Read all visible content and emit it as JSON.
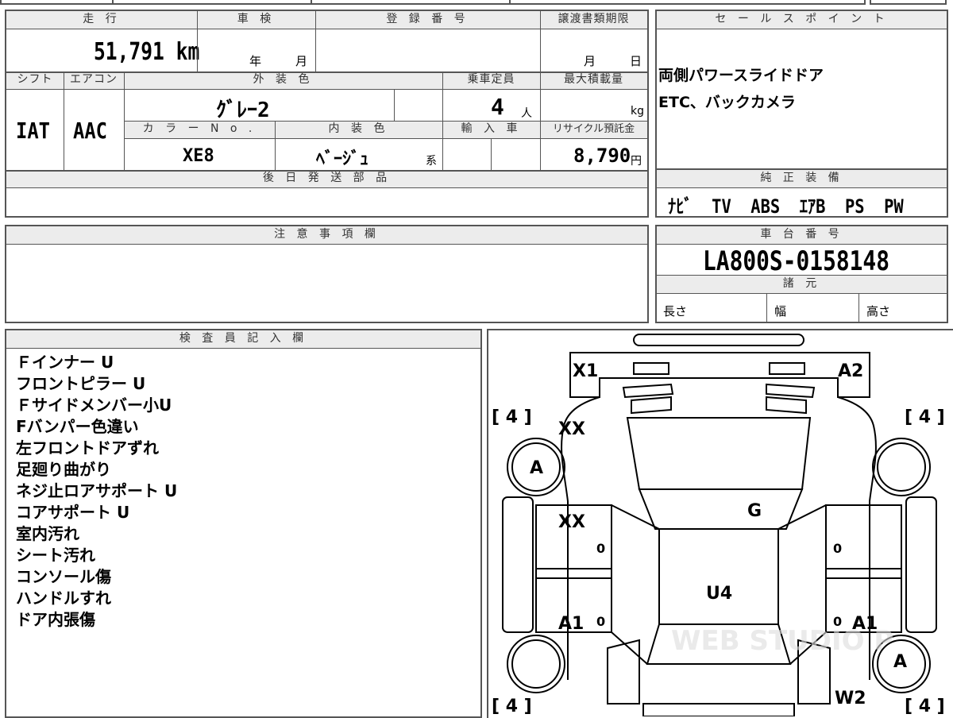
{
  "vehicle": {
    "mileage_label": "走 行",
    "mileage": "51,791 km",
    "inspection_label": "車 検",
    "inspection_year_unit": "年",
    "inspection_month_unit": "月",
    "registration_label": "登 録 番 号",
    "transfer_label": "譲渡書類期限",
    "transfer_month_unit": "月",
    "transfer_day_unit": "日",
    "shift_label": "シフト",
    "shift": "IAT",
    "aircon_label": "エアコン",
    "aircon": "AAC",
    "exterior_color_label": "外 装 色",
    "exterior_color": "ｸﾞﾚｰ2",
    "color_no_label": "カ ラ ー N o .",
    "color_no": "XE8",
    "interior_color_label": "内 装 色",
    "interior_color": "ﾍﾞｰｼﾞｭ",
    "interior_suffix": "系",
    "capacity_label": "乗車定員",
    "capacity": "4",
    "capacity_unit": "人",
    "max_load_label": "最大積載量",
    "max_load_unit": "kg",
    "import_label": "輸 入 車",
    "recycle_label": "リサイクル預託金",
    "recycle_fee": "8,790",
    "recycle_unit": "円",
    "later_parts_label": "後 日 発 送 部 品"
  },
  "sales_point": {
    "label": "セ ー ル ス ポ イ ン ト",
    "lines": [
      "両側パワースライドドア",
      "ETC、バックカメラ"
    ]
  },
  "equipment": {
    "label": "純 正 装 備",
    "value": "ﾅﾋﾞ  TV  ABS  ｴｱB  PS  PW"
  },
  "notes": {
    "label": "注 意 事 項 欄"
  },
  "chassis": {
    "label": "車 台 番 号",
    "number": "LA800S-0158148",
    "specs_label": "諸 元",
    "length_label": "長さ",
    "width_label": "幅",
    "height_label": "高さ"
  },
  "inspector": {
    "label": "検 査 員 記 入 欄",
    "lines": [
      "Ｆインナー U",
      "フロントピラー U",
      "Ｆサイドメンバー小U",
      "Fバンパー色違い",
      "左フロントドアずれ",
      "足廻り曲がり",
      "ネジ止ロアサポート U",
      "コアサポート U",
      "室内汚れ",
      "シート汚れ",
      "コンソール傷",
      "ハンドルすれ",
      "ドア内張傷"
    ]
  },
  "diagram": {
    "marks": {
      "front_left": "X1",
      "front_right": "A2",
      "left_front_fender": "XX",
      "left_front_tire": "A",
      "left_front_door": "XX",
      "hood_glass": "G",
      "roof": "U4",
      "left_rear_door": "A1",
      "right_rear_door": "A1",
      "right_rear_tire": "A",
      "rear_right": "W2"
    },
    "tread_fl": "[ 4 ]",
    "tread_fr": "[ 4 ]",
    "tread_rl": "[ 4 ]",
    "tread_rr": "[ 4 ]",
    "zero_a": "0",
    "zero_b": "0",
    "zero_c": "0",
    "zero_d": "0",
    "watermark": "WEB STUDIO P"
  }
}
